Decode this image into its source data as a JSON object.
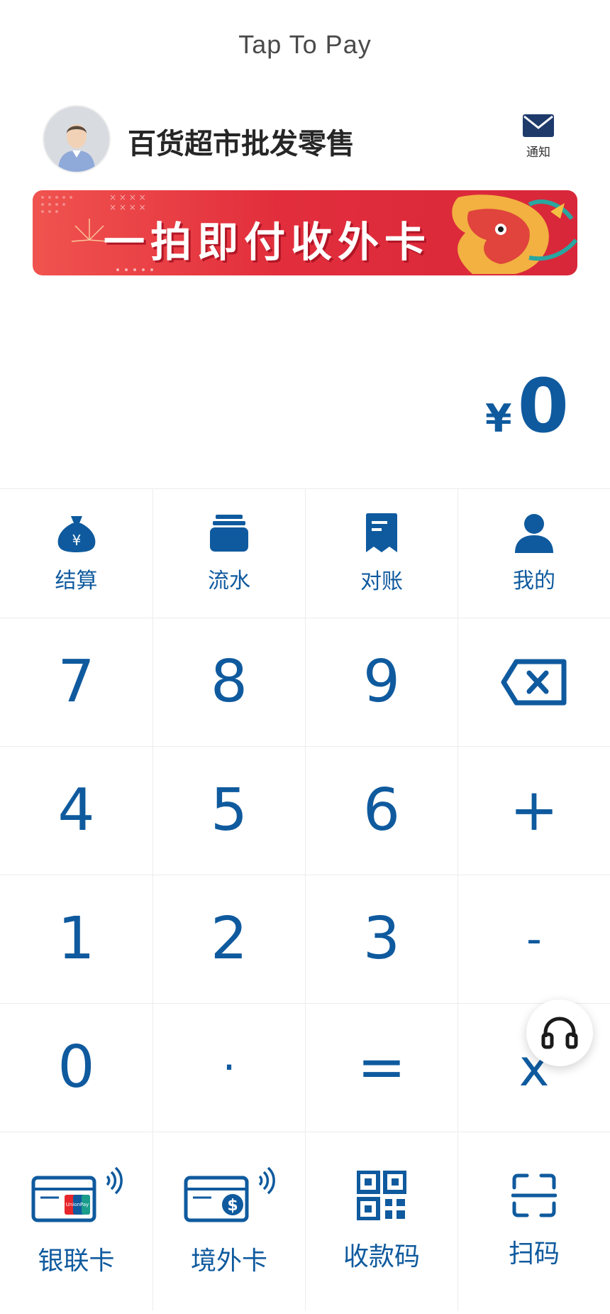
{
  "header": {
    "title": "Tap To Pay",
    "merchant_name": "百货超市批发零售",
    "notify_label": "通知"
  },
  "banner": {
    "text": "一拍即付收外卡"
  },
  "amount": {
    "currency_symbol": "¥",
    "value": "0"
  },
  "functions": [
    {
      "label": "结算",
      "icon": "money-bag-icon"
    },
    {
      "label": "流水",
      "icon": "stack-icon"
    },
    {
      "label": "对账",
      "icon": "receipt-icon"
    },
    {
      "label": "我的",
      "icon": "person-icon"
    }
  ],
  "keypad": {
    "rows": [
      [
        "7",
        "8",
        "9",
        "backspace"
      ],
      [
        "4",
        "5",
        "6",
        "+"
      ],
      [
        "1",
        "2",
        "3",
        "-"
      ],
      [
        "0",
        "·",
        "=",
        "x"
      ]
    ],
    "k7": "7",
    "k8": "8",
    "k9": "9",
    "k4": "4",
    "k5": "5",
    "k6": "6",
    "plus": "+",
    "k1": "1",
    "k2": "2",
    "k3": "3",
    "minus": "-",
    "k0": "0",
    "dot": "·",
    "equals": "=",
    "multiply": "x"
  },
  "payment_methods": [
    {
      "label": "银联卡",
      "icon": "unionpay-card-icon"
    },
    {
      "label": "境外卡",
      "icon": "foreign-card-icon"
    },
    {
      "label": "收款码",
      "icon": "qr-code-icon"
    },
    {
      "label": "扫码",
      "icon": "scan-icon"
    }
  ],
  "colors": {
    "accent": "#0f5a9e",
    "banner_red": "#e22e3c"
  }
}
